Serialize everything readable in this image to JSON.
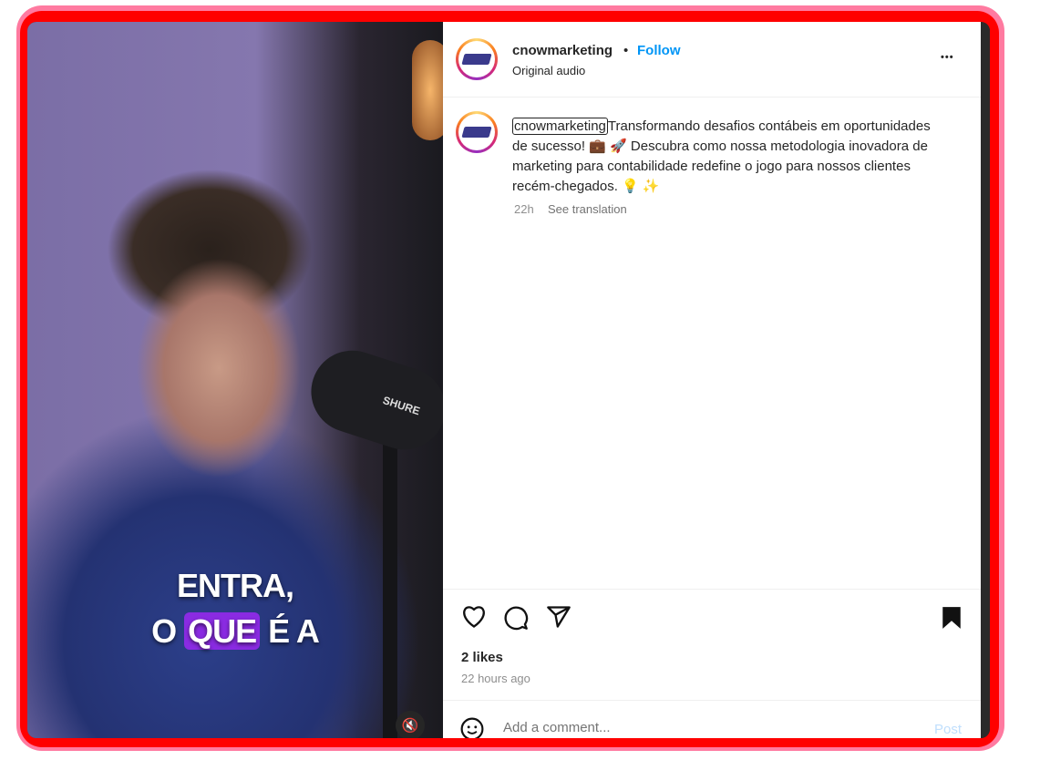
{
  "video": {
    "caption_line1": "ENTRA,",
    "caption_pre": "O ",
    "caption_highlight": "QUE",
    "caption_post": " É A",
    "mic_brand": "SHURE",
    "mute_icon": "speaker-muted-icon"
  },
  "header": {
    "username": "cnowmarketing",
    "dot": "•",
    "follow_label": "Follow",
    "audio": "Original audio",
    "more_label": "•••"
  },
  "caption": {
    "username": "cnowmarketing",
    "text": "Transformando desafios contábeis em oportunidades de sucesso! 💼 🚀  Descubra como nossa metodologia inovadora de marketing para contabilidade redefine o jogo para nossos clientes recém-chegados. 💡 ✨",
    "time": "22h",
    "see_translation": "See translation"
  },
  "actions": {
    "likes": "2 likes",
    "posted": "22 hours ago"
  },
  "comment": {
    "placeholder": "Add a comment...",
    "post_label": "Post"
  },
  "colors": {
    "follow": "#0095f6",
    "border_outer": "#ff7aa0",
    "border_inner": "#ff0000",
    "highlight": "#8a2be2"
  }
}
